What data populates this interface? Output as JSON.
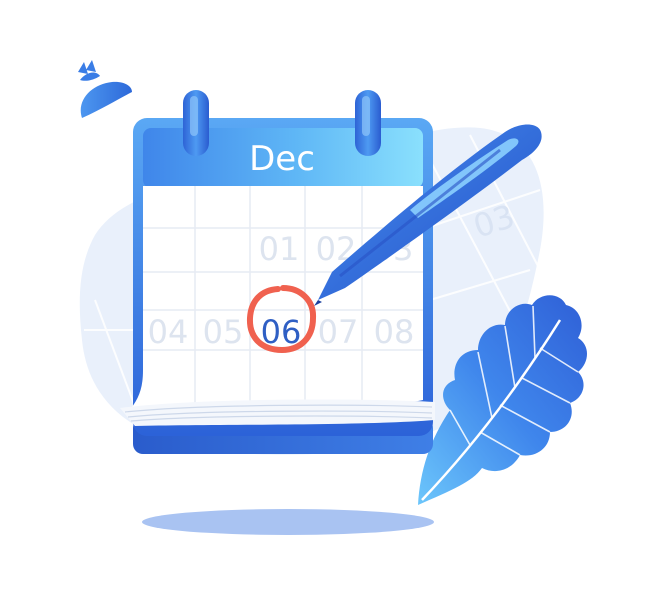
{
  "calendar": {
    "month": "Dec",
    "days_row1": [
      "01",
      "02",
      "03"
    ],
    "days_row2": [
      "04",
      "05",
      "06",
      "07",
      "08"
    ],
    "highlighted_day": "06",
    "background_day": "03"
  },
  "colors": {
    "primary": "#2f6fe0",
    "light_blue": "#79d4fb",
    "faint_blue": "#e8effb",
    "circle_red": "#f0614f",
    "day_text": "#dbe2ee",
    "highlight_text": "#2f5fc4"
  },
  "icons": [
    "calendar-icon",
    "pen-icon",
    "leaf-icon",
    "bird-icon"
  ]
}
